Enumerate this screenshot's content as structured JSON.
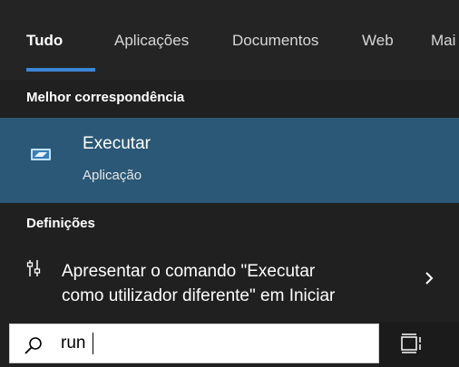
{
  "tabs": [
    {
      "label": "Tudo",
      "active": true
    },
    {
      "label": "Aplicações",
      "active": false
    },
    {
      "label": "Documentos",
      "active": false
    },
    {
      "label": "Web",
      "active": false
    },
    {
      "label": "Mai",
      "active": false
    }
  ],
  "best_match": {
    "header": "Melhor correspondência",
    "title": "Executar",
    "subtitle": "Aplicação",
    "icon": "run-app-icon"
  },
  "settings": {
    "header": "Definições",
    "item": {
      "line1": "Apresentar o comando \"Executar",
      "line2": "como utilizador diferente\" em Iniciar",
      "icon": "settings-sliders-icon"
    }
  },
  "search": {
    "value": "run"
  },
  "colors": {
    "accent": "#3b86d6",
    "selection": "#2b5876",
    "background": "#202020"
  }
}
